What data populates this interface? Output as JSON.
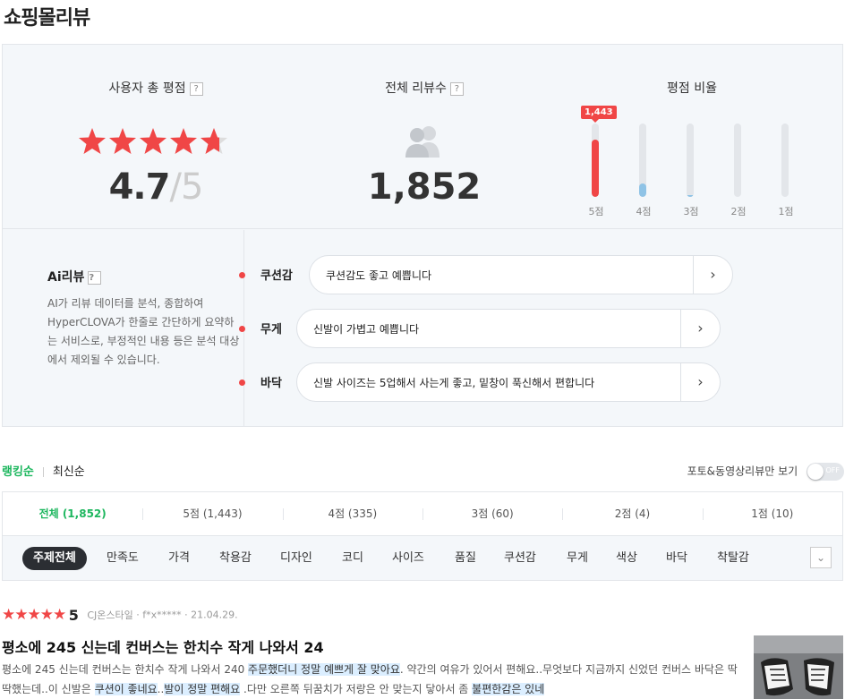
{
  "page_title": "쇼핑몰리뷰",
  "summary": {
    "rating": {
      "title": "사용자 총 평점",
      "help": "?",
      "value": "4.7",
      "max": "5",
      "stars": 4.7
    },
    "count": {
      "title": "전체 리뷰수",
      "help": "?",
      "value": "1,852",
      "icon": "people-icon"
    },
    "ratio": {
      "title": "평점 비율",
      "tooltip": "1,443",
      "bars": [
        {
          "label": "5점",
          "fraction": 0.78,
          "color": "#f04646"
        },
        {
          "label": "4점",
          "fraction": 0.18,
          "color": "#8fc3e6"
        },
        {
          "label": "3점",
          "fraction": 0.03,
          "color": "#8fc3e6"
        },
        {
          "label": "2점",
          "fraction": 0.0,
          "color": "#8fc3e6"
        },
        {
          "label": "1점",
          "fraction": 0.0,
          "color": "#8fc3e6"
        }
      ]
    }
  },
  "ai": {
    "title": "Ai리뷰",
    "help": "?",
    "description": "AI가 리뷰 데이터를 분석, 종합하여 HyperCLOVA가 한줄로 간단하게 요약하는 서비스로, 부정적인 내용 등은 분석 대상에서 제외될 수 있습니다.",
    "rows": [
      {
        "key": "쿠션감",
        "text": "쿠션감도 좋고 예쁩니다"
      },
      {
        "key": "무게",
        "text": "신발이 가볍고 예쁩니다"
      },
      {
        "key": "바닥",
        "text": "신발 사이즈는 5업해서 사는게 좋고, 밑창이 푹신해서 편합니다"
      }
    ],
    "arrow": "›"
  },
  "sort": {
    "options": [
      "랭킹순",
      "최신순"
    ],
    "active": "랭킹순"
  },
  "photo_filter": {
    "label": "포토&동영상리뷰만 보기",
    "toggle": "OFF"
  },
  "score_tabs": [
    "전체 (1,852)",
    "5점 (1,443)",
    "4점 (335)",
    "3점 (60)",
    "2점 (4)",
    "1점 (10)"
  ],
  "topics": [
    "주제전체",
    "만족도",
    "가격",
    "착용감",
    "디자인",
    "코디",
    "사이즈",
    "품질",
    "쿠션감",
    "무게",
    "색상",
    "바닥",
    "착탈감"
  ],
  "topic_more": "⌄",
  "review": {
    "stars": "★★★★★",
    "score": "5",
    "shop": "CJ온스타일",
    "user": "f*x*****",
    "date": "21.04.29.",
    "title": "평소에 245 신는데 컨버스는 한치수 작게 나와서 24",
    "body_parts": [
      {
        "t": "평소에 245 신는데 컨버스는 한치수 작게 나와서 240 ",
        "hl": false
      },
      {
        "t": "주문했더니 정말 예쁘게 잘 맞아요",
        "hl": true
      },
      {
        "t": ". 약간의 여유가 있어서 편해요..무엇보다 지금까지 신었던 컨버스 바닥은 딱딱했는데..이 신발은 ",
        "hl": false
      },
      {
        "t": "쿠션이 좋네요",
        "hl": true
      },
      {
        "t": "..",
        "hl": false
      },
      {
        "t": "발이 정말 편해요",
        "hl": true
      },
      {
        "t": " .다만 오른쪽 뒤꿈치가 저랑은 안 맞는지 닿아서 좀 ",
        "hl": false
      },
      {
        "t": "불편한감은 있네",
        "hl": true
      }
    ]
  }
}
